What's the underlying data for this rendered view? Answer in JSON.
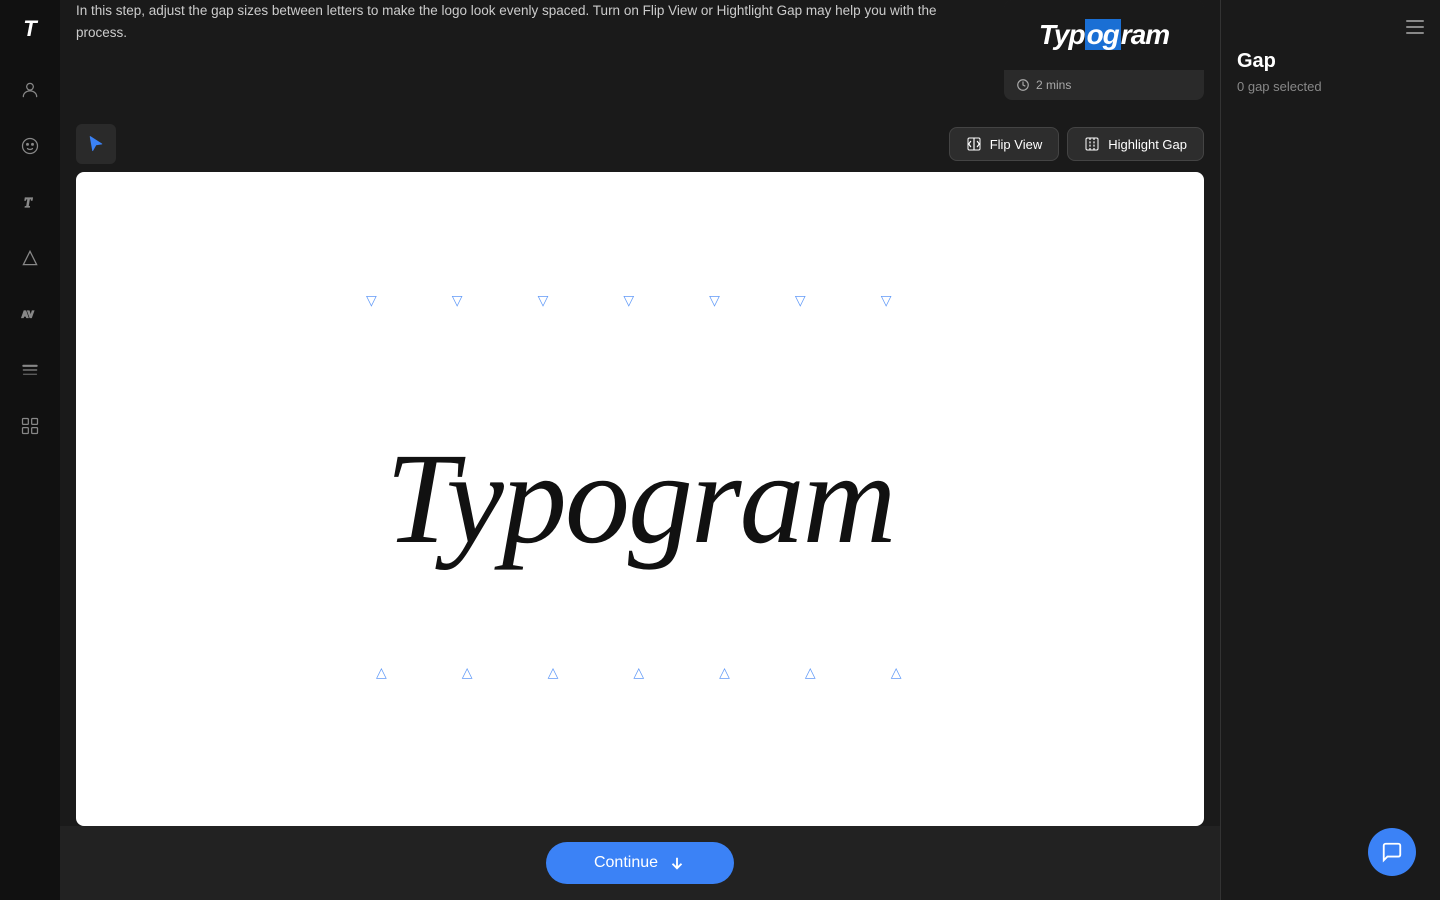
{
  "app": {
    "logo": "T",
    "title": "Typogram"
  },
  "sidebar": {
    "icons": [
      {
        "name": "user-icon",
        "symbol": "👤",
        "label": "User"
      },
      {
        "name": "face-icon",
        "symbol": "😶",
        "label": "Face"
      },
      {
        "name": "text-icon",
        "symbol": "T",
        "label": "Text"
      },
      {
        "name": "shape-icon",
        "symbol": "✦",
        "label": "Shape"
      },
      {
        "name": "spacing-icon",
        "symbol": "AV",
        "label": "Spacing"
      },
      {
        "name": "weight-icon",
        "symbol": "≡",
        "label": "Weight"
      },
      {
        "name": "grid-icon",
        "symbol": "⊞",
        "label": "Grid"
      }
    ]
  },
  "instruction": {
    "body": "In this step, adjust the gap sizes between letters to make the logo look evenly spaced. Turn on Flip View or Hightlight Gap may help you with the process."
  },
  "preview": {
    "logo_text_before": "Typ",
    "logo_text_highlight": "og",
    "logo_text_after": "ram",
    "duration": "2 mins"
  },
  "toolbar": {
    "cursor_label": "cursor",
    "flip_view_label": "Flip View",
    "highlight_gap_label": "Highlight Gap"
  },
  "canvas": {
    "logo_text": "Typogram"
  },
  "right_panel": {
    "title": "Gap",
    "subtitle": "0 gap selected",
    "menu_label": "Menu"
  },
  "bottom": {
    "continue_label": "Continue"
  },
  "gap_markers": {
    "top": [
      "▽",
      "▽",
      "▽",
      "▽",
      "▽",
      "▽",
      "▽"
    ],
    "bottom": [
      "△",
      "△",
      "△",
      "△",
      "△",
      "△",
      "△"
    ]
  },
  "colors": {
    "accent": "#3b82f6",
    "background": "#1a1a1a",
    "surface": "#2a2a2a",
    "text_primary": "#ffffff",
    "text_secondary": "#cccccc",
    "text_muted": "#888888"
  }
}
